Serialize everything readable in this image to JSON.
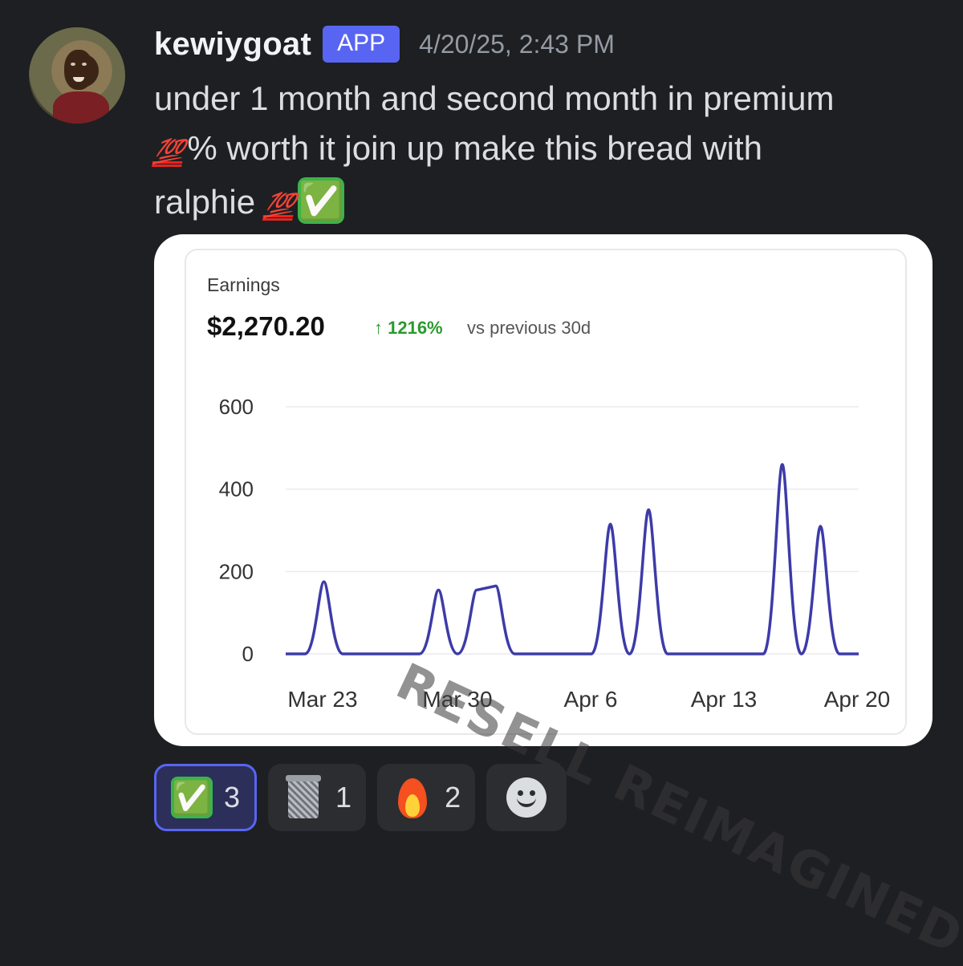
{
  "message": {
    "username": "kewiygoat",
    "tag": "APP",
    "timestamp": "4/20/25, 2:43 PM",
    "line1": "under 1 month and second month in premium",
    "line2_emoji": "💯",
    "line2_text": "% worth it join up make this bread with",
    "line3_text": "ralphie",
    "line3_emoji": "💯",
    "line3_check": "✅"
  },
  "card": {
    "label": "Earnings",
    "value": "$2,270.20",
    "change": "↑ 1216%",
    "compare": "vs previous 30d",
    "watermark": "RESELL REIMAGINED"
  },
  "chart_data": {
    "type": "line",
    "title": "Earnings",
    "ylim": [
      0,
      600
    ],
    "yticks": [
      "600",
      "400",
      "200",
      "0"
    ],
    "xticks": [
      "Mar 23",
      "Mar 30",
      "Apr 6",
      "Apr 13",
      "Apr 20"
    ],
    "grid": true,
    "series": [
      {
        "color": "#3d3ba8",
        "points": [
          [
            0,
            0
          ],
          [
            1,
            0
          ],
          [
            2,
            175
          ],
          [
            3,
            0
          ],
          [
            4,
            0
          ],
          [
            5,
            0
          ],
          [
            6,
            0
          ],
          [
            7,
            0
          ],
          [
            8,
            155
          ],
          [
            9,
            0
          ],
          [
            10,
            155
          ],
          [
            11,
            165
          ],
          [
            12,
            0
          ],
          [
            13,
            0
          ],
          [
            14,
            0
          ],
          [
            15,
            0
          ],
          [
            16,
            0
          ],
          [
            17,
            315
          ],
          [
            18,
            0
          ],
          [
            19,
            350
          ],
          [
            20,
            0
          ],
          [
            21,
            0
          ],
          [
            22,
            0
          ],
          [
            23,
            0
          ],
          [
            24,
            0
          ],
          [
            25,
            0
          ],
          [
            26,
            460
          ],
          [
            27,
            0
          ],
          [
            28,
            310
          ],
          [
            29,
            0
          ],
          [
            30,
            0
          ]
        ]
      }
    ]
  },
  "reactions": [
    {
      "emoji": "✅",
      "count": "3"
    },
    {
      "emoji": "wastebasket",
      "count": "1"
    },
    {
      "emoji": "🔥",
      "count": "2"
    },
    {
      "emoji": "add-reaction",
      "count": ""
    }
  ]
}
